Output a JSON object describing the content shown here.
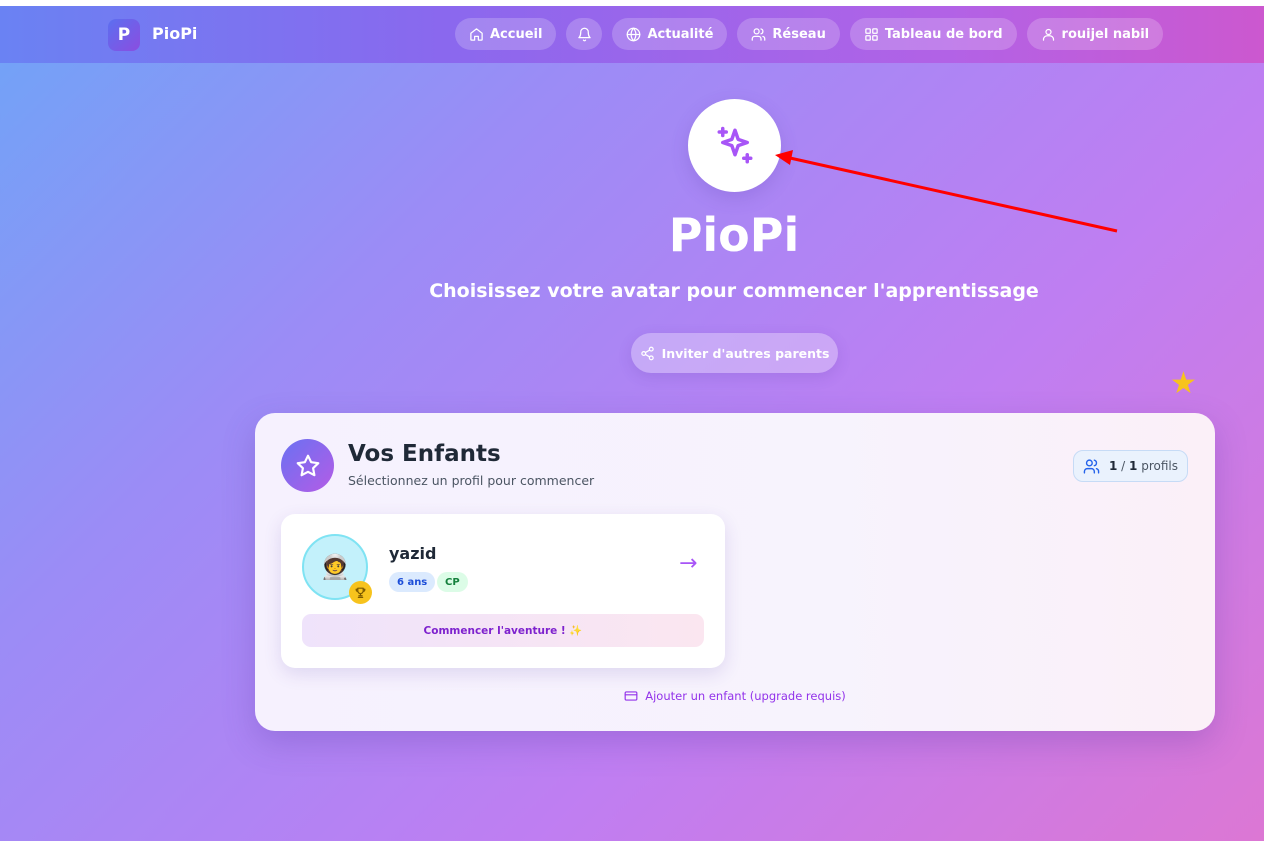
{
  "app": {
    "logo_letter": "P",
    "name": "PioPi"
  },
  "nav": {
    "home": "Accueil",
    "news": "Actualité",
    "network": "Réseau",
    "dashboard": "Tableau de bord",
    "user": "rouijel nabil"
  },
  "hero": {
    "title": "PioPi",
    "subtitle": "Choisissez votre avatar pour commencer l'apprentissage",
    "invite_label": "Inviter d'autres parents"
  },
  "panel": {
    "title": "Vos Enfants",
    "subtitle": "Sélectionnez un profil pour commencer",
    "count_current": "1",
    "count_sep": " / ",
    "count_max": "1",
    "count_unit": "profils",
    "add_child_label": "Ajouter un enfant (upgrade requis)"
  },
  "children": [
    {
      "name": "yazid",
      "age": "6 ans",
      "grade": "CP",
      "avatar": "🧑‍🚀",
      "action_label": "Commencer l'aventure ! ✨"
    }
  ],
  "colors": {
    "accent": "#a855f7",
    "star": "#f7c31d",
    "arrow": "#ff0000"
  },
  "icons": [
    "home-icon",
    "bell-icon",
    "globe-icon",
    "users-icon",
    "grid-icon",
    "user-icon",
    "sparkles-icon",
    "share-icon",
    "star-icon",
    "trophy-icon",
    "credit-card-icon"
  ]
}
